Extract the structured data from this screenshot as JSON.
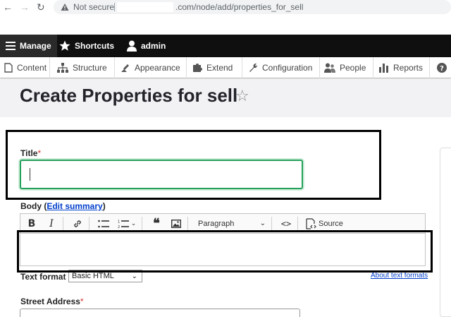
{
  "browser": {
    "security_label": "Not secure",
    "url_suffix": ".com/node/add/properties_for_sell"
  },
  "toolbar": {
    "manage": "Manage",
    "shortcuts": "Shortcuts",
    "user": "admin"
  },
  "tray": {
    "items": [
      "Content",
      "Structure",
      "Appearance",
      "Extend",
      "Configuration",
      "People",
      "Reports"
    ]
  },
  "page": {
    "title": "Create Properties for sell",
    "star": "☆"
  },
  "form": {
    "title_label": "Title",
    "required_mark": "*",
    "body_label": "Body",
    "body_open_paren": "(",
    "body_edit_summary": "Edit summary",
    "body_close_paren": ")",
    "editor": {
      "paragraph_select": "Paragraph",
      "source_label": "Source"
    },
    "text_format_label": "Text format",
    "text_format_value": "Basic HTML",
    "about_text_formats": "About text formats",
    "street_label": "Street Address"
  },
  "colors": {
    "toolbar_bg": "#0f0f0f",
    "focus_green": "#25a05a",
    "link_blue": "#003ecc",
    "required_red": "#d3322e"
  }
}
